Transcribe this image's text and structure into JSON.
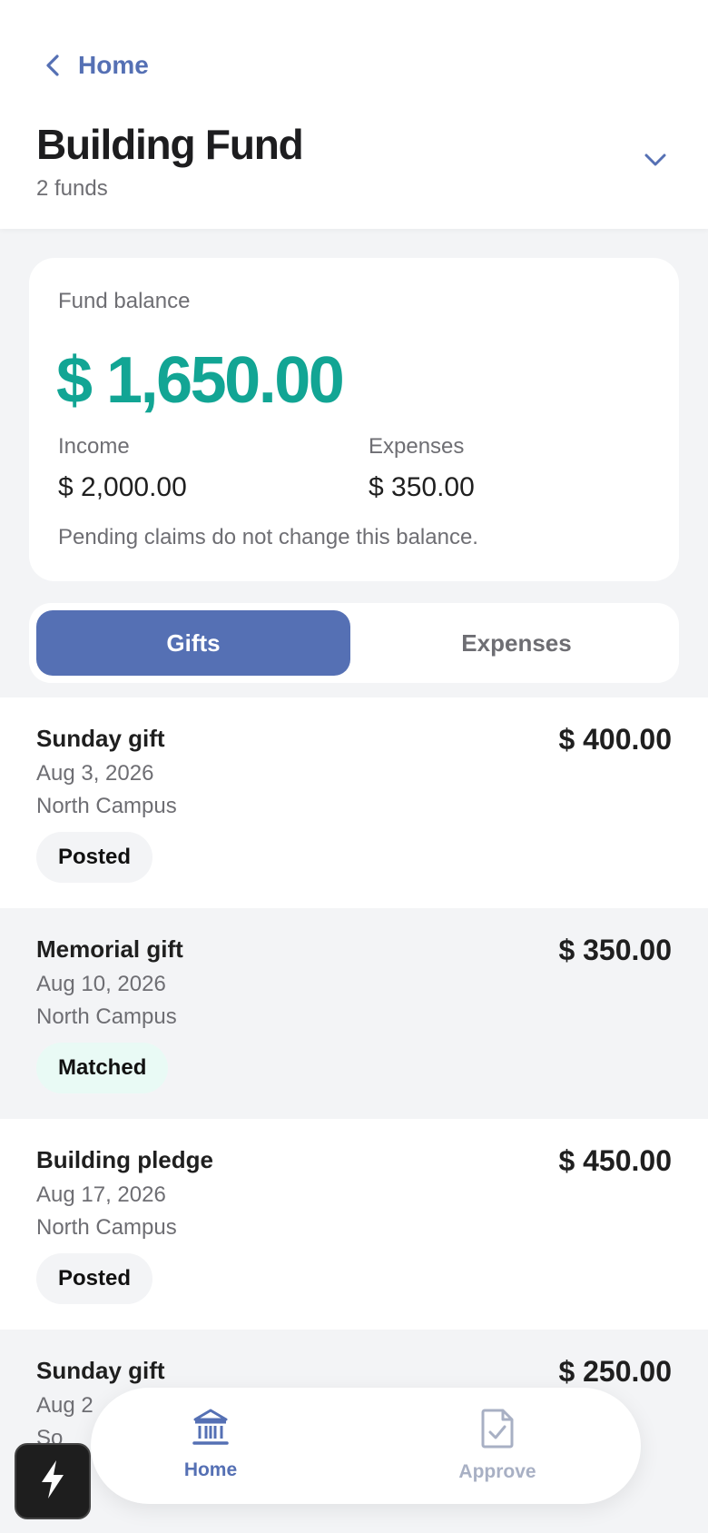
{
  "header": {
    "back_label": "Home",
    "title": "Building Fund",
    "subtitle": "2 funds"
  },
  "balance": {
    "label": "Fund balance",
    "amount": "$ 1,650.00",
    "income_label": "Income",
    "income_value": "$ 2,000.00",
    "expenses_label": "Expenses",
    "expenses_value": "$ 350.00",
    "note": "Pending claims do not change this balance."
  },
  "tabs": [
    {
      "label": "Gifts",
      "active": true
    },
    {
      "label": "Expenses",
      "active": false
    }
  ],
  "gifts": [
    {
      "name": "Sunday gift",
      "date": "Aug 3, 2026",
      "campus": "North Campus",
      "amount": "$ 400.00",
      "status": "Posted"
    },
    {
      "name": "Memorial gift",
      "date": "Aug 10, 2026",
      "campus": "North Campus",
      "amount": "$ 350.00",
      "status": "Matched"
    },
    {
      "name": "Building pledge",
      "date": "Aug 17, 2026",
      "campus": "North Campus",
      "amount": "$ 450.00",
      "status": "Posted"
    },
    {
      "name": "Sunday gift",
      "date": "Aug 2",
      "campus": "So",
      "amount": "$ 250.00",
      "status": ""
    }
  ],
  "bottom_nav": {
    "home_label": "Home",
    "approve_label": "Approve"
  },
  "colors": {
    "accent": "#5570b4",
    "balance_green": "#12a594",
    "matched_bg": "#e9faf5"
  },
  "icons": {
    "back": "chevron-left-icon",
    "dropdown": "chevron-down-icon",
    "home": "bank-icon",
    "approve": "document-check-icon",
    "fab": "lightning-icon"
  }
}
